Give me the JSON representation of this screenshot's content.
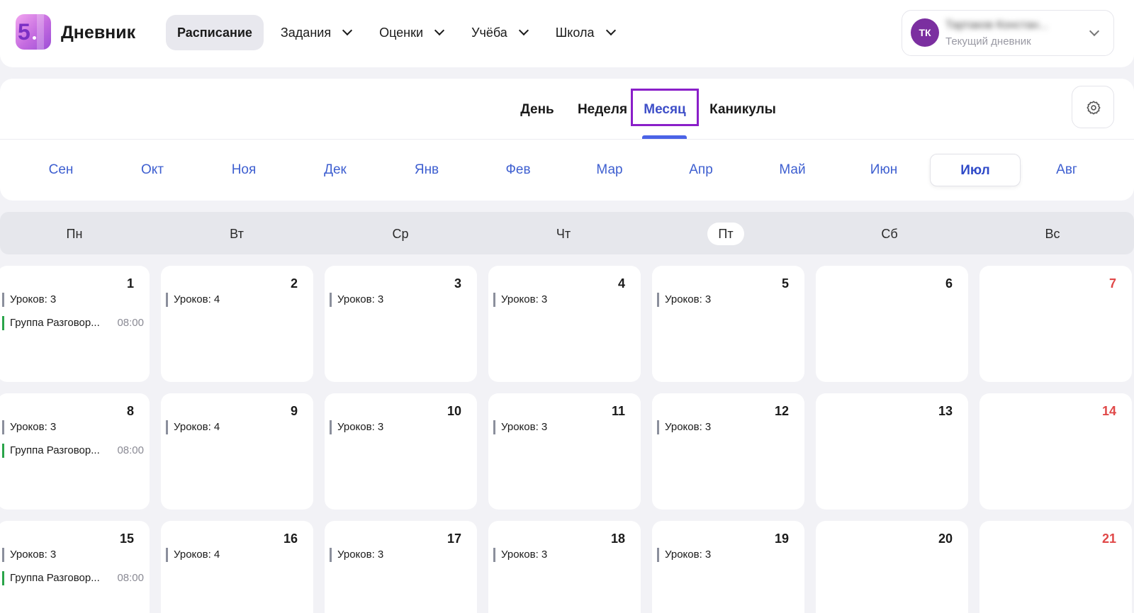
{
  "header": {
    "logo_digit": "5",
    "brand": "Дневник",
    "nav": [
      {
        "label": "Расписание",
        "active": true,
        "has_dropdown": false
      },
      {
        "label": "Задания",
        "active": false,
        "has_dropdown": true
      },
      {
        "label": "Оценки",
        "active": false,
        "has_dropdown": true
      },
      {
        "label": "Учёба",
        "active": false,
        "has_dropdown": true
      },
      {
        "label": "Школа",
        "active": false,
        "has_dropdown": true
      }
    ],
    "profile": {
      "initials": "ТК",
      "name": "Тартаков Констан...",
      "subtitle": "Текущий дневник"
    }
  },
  "view_tabs": [
    {
      "label": "День",
      "active": false
    },
    {
      "label": "Неделя",
      "active": false
    },
    {
      "label": "Месяц",
      "active": true
    },
    {
      "label": "Каникулы",
      "active": false
    }
  ],
  "months": [
    {
      "label": "Сен",
      "active": false
    },
    {
      "label": "Окт",
      "active": false
    },
    {
      "label": "Ноя",
      "active": false
    },
    {
      "label": "Дек",
      "active": false
    },
    {
      "label": "Янв",
      "active": false
    },
    {
      "label": "Фев",
      "active": false
    },
    {
      "label": "Мар",
      "active": false
    },
    {
      "label": "Апр",
      "active": false
    },
    {
      "label": "Май",
      "active": false
    },
    {
      "label": "Июн",
      "active": false
    },
    {
      "label": "Июл",
      "active": true
    },
    {
      "label": "Авг",
      "active": false
    }
  ],
  "weekdays": [
    {
      "label": "Пн",
      "today": false
    },
    {
      "label": "Вт",
      "today": false
    },
    {
      "label": "Ср",
      "today": false
    },
    {
      "label": "Чт",
      "today": false
    },
    {
      "label": "Пт",
      "today": true
    },
    {
      "label": "Сб",
      "today": false
    },
    {
      "label": "Вс",
      "today": false
    }
  ],
  "calendar": {
    "weeks": [
      [
        {
          "day": "1",
          "weekend": false,
          "events": [
            {
              "type": "lessons",
              "text": "Уроков: 3"
            },
            {
              "type": "group",
              "text": "Группа Разговор...",
              "time": "08:00"
            }
          ]
        },
        {
          "day": "2",
          "weekend": false,
          "events": [
            {
              "type": "lessons",
              "text": "Уроков: 4"
            }
          ]
        },
        {
          "day": "3",
          "weekend": false,
          "events": [
            {
              "type": "lessons",
              "text": "Уроков: 3"
            }
          ]
        },
        {
          "day": "4",
          "weekend": false,
          "events": [
            {
              "type": "lessons",
              "text": "Уроков: 3"
            }
          ]
        },
        {
          "day": "5",
          "weekend": false,
          "events": [
            {
              "type": "lessons",
              "text": "Уроков: 3"
            }
          ]
        },
        {
          "day": "6",
          "weekend": false,
          "events": []
        },
        {
          "day": "7",
          "weekend": true,
          "events": []
        }
      ],
      [
        {
          "day": "8",
          "weekend": false,
          "events": [
            {
              "type": "lessons",
              "text": "Уроков: 3"
            },
            {
              "type": "group",
              "text": "Группа Разговор...",
              "time": "08:00"
            }
          ]
        },
        {
          "day": "9",
          "weekend": false,
          "events": [
            {
              "type": "lessons",
              "text": "Уроков: 4"
            }
          ]
        },
        {
          "day": "10",
          "weekend": false,
          "events": [
            {
              "type": "lessons",
              "text": "Уроков: 3"
            }
          ]
        },
        {
          "day": "11",
          "weekend": false,
          "events": [
            {
              "type": "lessons",
              "text": "Уроков: 3"
            }
          ]
        },
        {
          "day": "12",
          "weekend": false,
          "events": [
            {
              "type": "lessons",
              "text": "Уроков: 3"
            }
          ]
        },
        {
          "day": "13",
          "weekend": false,
          "events": []
        },
        {
          "day": "14",
          "weekend": true,
          "events": []
        }
      ],
      [
        {
          "day": "15",
          "weekend": false,
          "events": [
            {
              "type": "lessons",
              "text": "Уроков: 3"
            },
            {
              "type": "group",
              "text": "Группа Разговор...",
              "time": "08:00"
            }
          ]
        },
        {
          "day": "16",
          "weekend": false,
          "events": [
            {
              "type": "lessons",
              "text": "Уроков: 4"
            }
          ]
        },
        {
          "day": "17",
          "weekend": false,
          "events": [
            {
              "type": "lessons",
              "text": "Уроков: 3"
            }
          ]
        },
        {
          "day": "18",
          "weekend": false,
          "events": [
            {
              "type": "lessons",
              "text": "Уроков: 3"
            }
          ]
        },
        {
          "day": "19",
          "weekend": false,
          "events": [
            {
              "type": "lessons",
              "text": "Уроков: 3"
            }
          ]
        },
        {
          "day": "20",
          "weekend": false,
          "events": []
        },
        {
          "day": "21",
          "weekend": true,
          "events": []
        }
      ]
    ]
  },
  "colors": {
    "accent": "#3e4fc8",
    "tab_highlight": "#8a1fc9",
    "weekend": "#e04848",
    "lessons_marker": "#8b8f9c",
    "group_marker": "#2aa44a",
    "avatar": "#7b2fa0"
  },
  "icons": {
    "settings": "gear-icon",
    "dropdown": "chevron-down-icon"
  }
}
